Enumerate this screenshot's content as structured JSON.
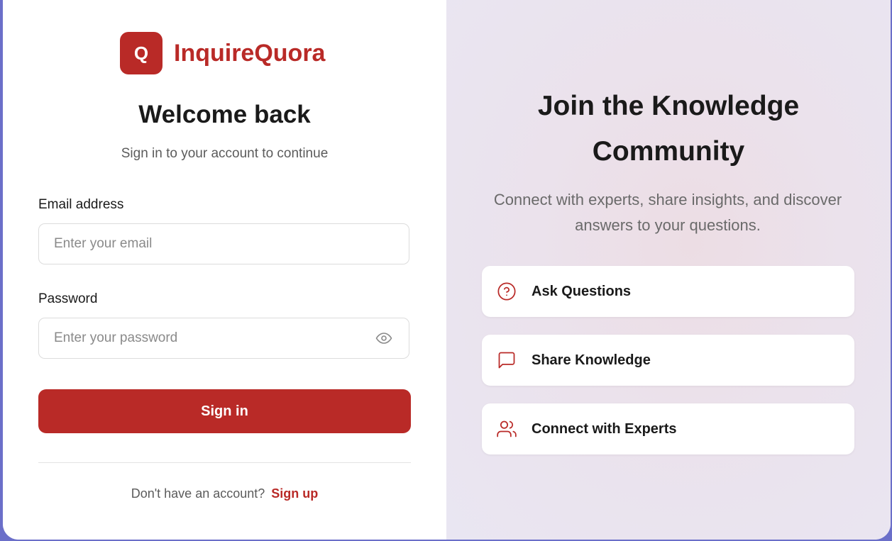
{
  "brand": {
    "logo_letter": "Q",
    "name": "InquireQuora",
    "color": "#b92a27"
  },
  "login": {
    "title": "Welcome back",
    "subtitle": "Sign in to your account to continue",
    "email_label": "Email address",
    "email_placeholder": "Enter your email",
    "password_label": "Password",
    "password_placeholder": "Enter your password",
    "sign_in_label": "Sign in",
    "no_account_text": "Don't have an account?",
    "sign_up_label": "Sign up"
  },
  "promo": {
    "title_line1": "Join the Knowledge",
    "title_line2": "Community",
    "subtitle_line1": "Connect with experts, share insights, and discover",
    "subtitle_line2": "answers to your questions.",
    "features": [
      {
        "icon": "question-circle-icon",
        "label": "Ask Questions"
      },
      {
        "icon": "message-square-icon",
        "label": "Share Knowledge"
      },
      {
        "icon": "users-icon",
        "label": "Connect with Experts"
      }
    ]
  }
}
